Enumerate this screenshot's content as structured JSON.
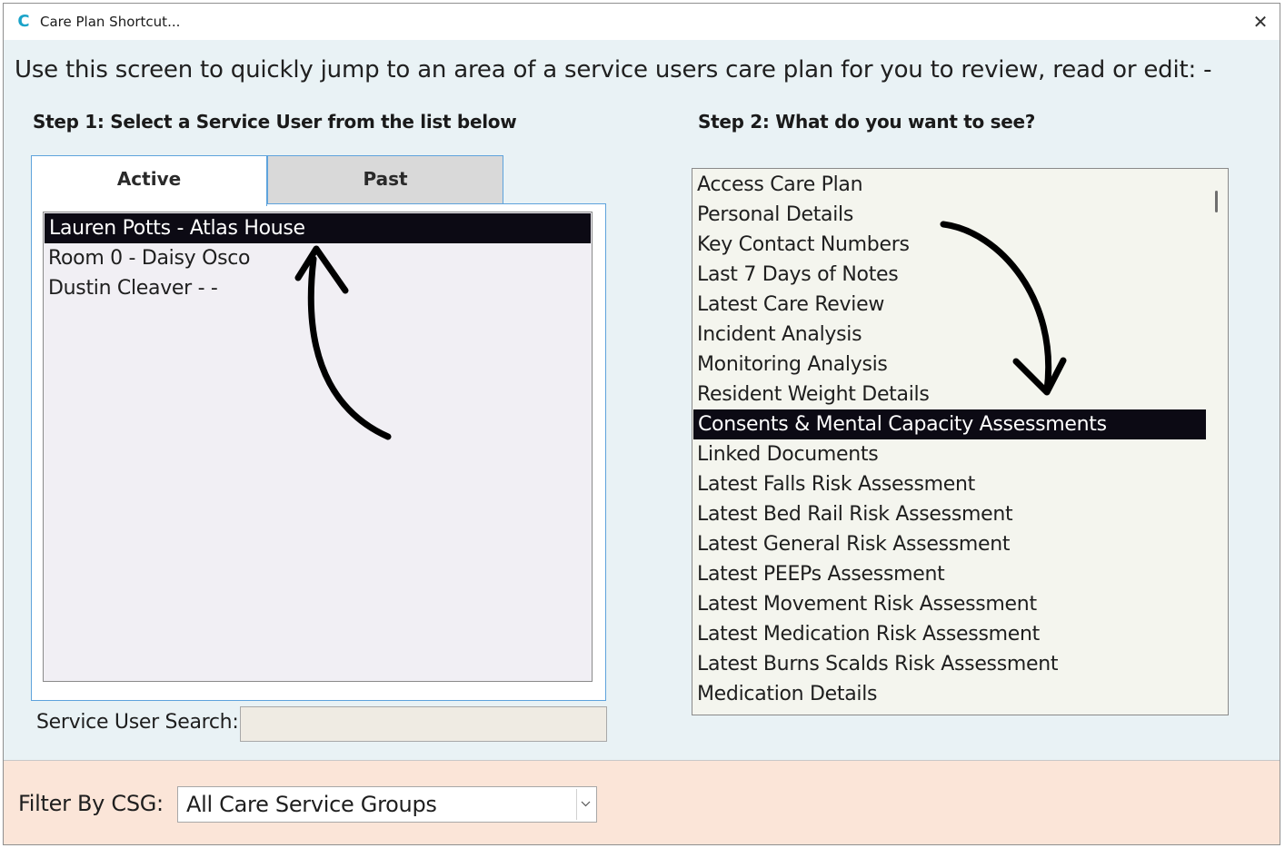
{
  "window": {
    "title": "Care Plan Shortcut...",
    "app_icon": "care-app-icon",
    "icon_glyph": "C",
    "close_glyph": "✕"
  },
  "intro_text": "Use this screen to quickly jump to an area of a service users care plan for you to review, read or edit: -",
  "step1": {
    "title": "Step 1: Select a Service User from the list below",
    "tabs": [
      {
        "label": "Active",
        "selected": true
      },
      {
        "label": "Past",
        "selected": false
      }
    ],
    "users": [
      {
        "label": "Lauren Potts - Atlas House",
        "selected": true
      },
      {
        "label": "Room 0 - Daisy Osco",
        "selected": false
      },
      {
        "label": "Dustin Cleaver - -",
        "selected": false
      }
    ],
    "search": {
      "label": "Service User Search:",
      "value": "",
      "placeholder": ""
    }
  },
  "step2": {
    "title": "Step 2: What do you want to see?",
    "options": [
      {
        "label": "Access Care Plan",
        "selected": false
      },
      {
        "label": "Personal Details",
        "selected": false
      },
      {
        "label": "Key Contact Numbers",
        "selected": false
      },
      {
        "label": "Last 7 Days of Notes",
        "selected": false
      },
      {
        "label": "Latest Care Review",
        "selected": false
      },
      {
        "label": "Incident Analysis",
        "selected": false
      },
      {
        "label": "Monitoring Analysis",
        "selected": false
      },
      {
        "label": "Resident Weight Details",
        "selected": false
      },
      {
        "label": "Consents & Mental Capacity Assessments",
        "selected": true
      },
      {
        "label": "Linked Documents",
        "selected": false
      },
      {
        "label": "Latest Falls Risk Assessment",
        "selected": false
      },
      {
        "label": "Latest Bed Rail Risk Assessment",
        "selected": false
      },
      {
        "label": "Latest General Risk Assessment",
        "selected": false
      },
      {
        "label": "Latest PEEPs Assessment",
        "selected": false
      },
      {
        "label": "Latest Movement Risk Assessment",
        "selected": false
      },
      {
        "label": "Latest Medication Risk Assessment",
        "selected": false
      },
      {
        "label": "Latest Burns Scalds Risk Assessment",
        "selected": false
      },
      {
        "label": "Medication Details",
        "selected": false
      }
    ]
  },
  "footer": {
    "filter_label": "Filter By CSG:",
    "csg_value": "All Care Service Groups"
  },
  "colors": {
    "content_bg": "#e9f2f5",
    "footer_bg": "#fbe5d8",
    "selection_bg": "#0c0a14",
    "tab_border": "#5ea3dc",
    "icon_accent": "#1aa3c9"
  }
}
